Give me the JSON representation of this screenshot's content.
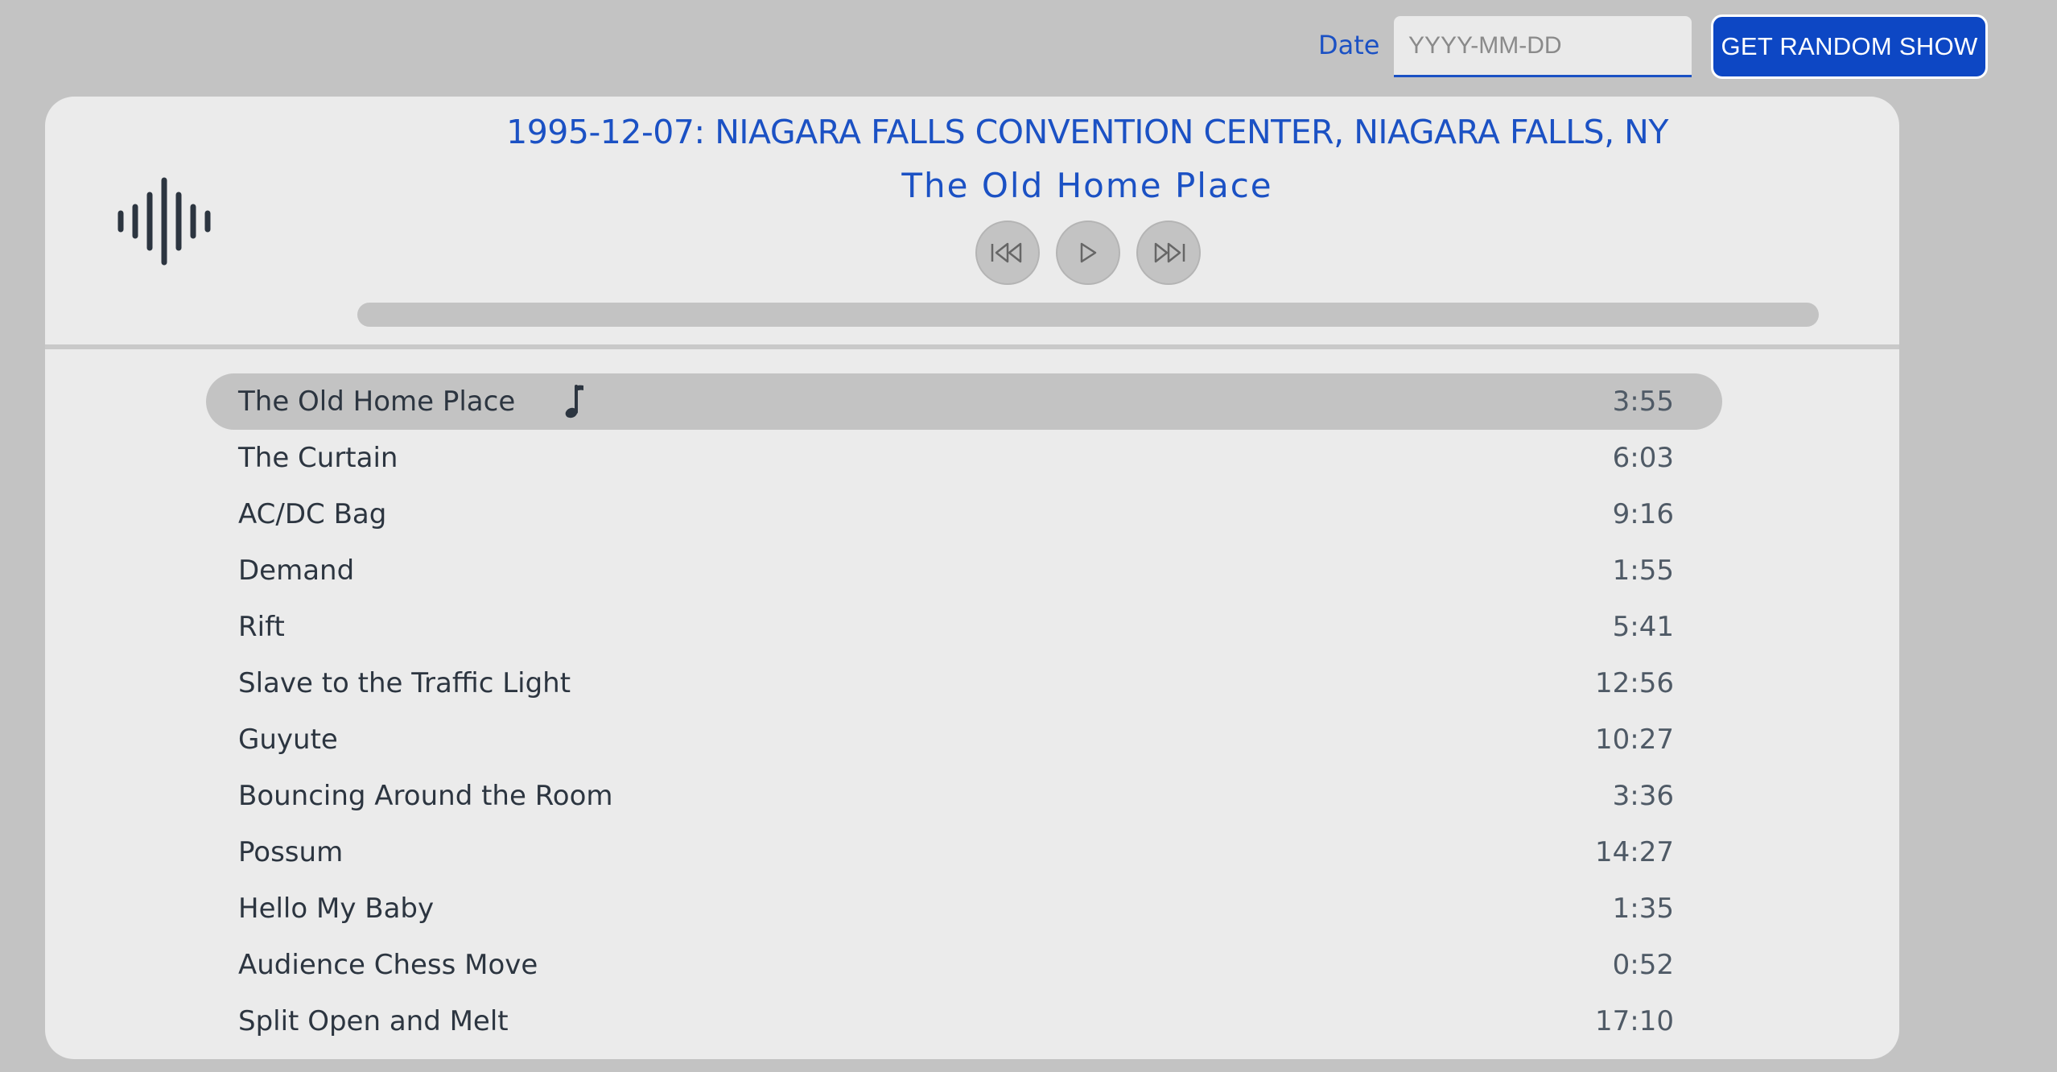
{
  "header": {
    "date_label": "Date",
    "date_input_value": "",
    "date_placeholder": "YYYY-MM-DD",
    "random_show_label": "GET RANDOM SHOW"
  },
  "player": {
    "show_title": "1995-12-07: NIAGARA FALLS CONVENTION CENTER, NIAGARA FALLS, NY",
    "now_playing": "The Old Home Place",
    "is_playing": false,
    "progress_fraction": 0.0,
    "controls": [
      {
        "name": "previous-track",
        "icon": "skip-back-icon"
      },
      {
        "name": "play",
        "icon": "play-icon"
      },
      {
        "name": "next-track",
        "icon": "skip-forward-icon"
      }
    ]
  },
  "tracks": [
    {
      "title": "The Old Home Place",
      "duration": "3:55",
      "active": true
    },
    {
      "title": "The Curtain",
      "duration": "6:03",
      "active": false
    },
    {
      "title": "AC/DC Bag",
      "duration": "9:16",
      "active": false
    },
    {
      "title": "Demand",
      "duration": "1:55",
      "active": false
    },
    {
      "title": "Rift",
      "duration": "5:41",
      "active": false
    },
    {
      "title": "Slave to the Traffic Light",
      "duration": "12:56",
      "active": false
    },
    {
      "title": "Guyute",
      "duration": "10:27",
      "active": false
    },
    {
      "title": "Bouncing Around the Room",
      "duration": "3:36",
      "active": false
    },
    {
      "title": "Possum",
      "duration": "14:27",
      "active": false
    },
    {
      "title": "Hello My Baby",
      "duration": "1:35",
      "active": false
    },
    {
      "title": "Audience Chess Move",
      "duration": "0:52",
      "active": false
    },
    {
      "title": "Split Open and Melt",
      "duration": "17:10",
      "active": false
    }
  ],
  "colors": {
    "accent": "#1b51c4",
    "button": "#0d47c4",
    "background": "#c3c3c3",
    "card": "#ebebeb",
    "text": "#2c3540"
  }
}
